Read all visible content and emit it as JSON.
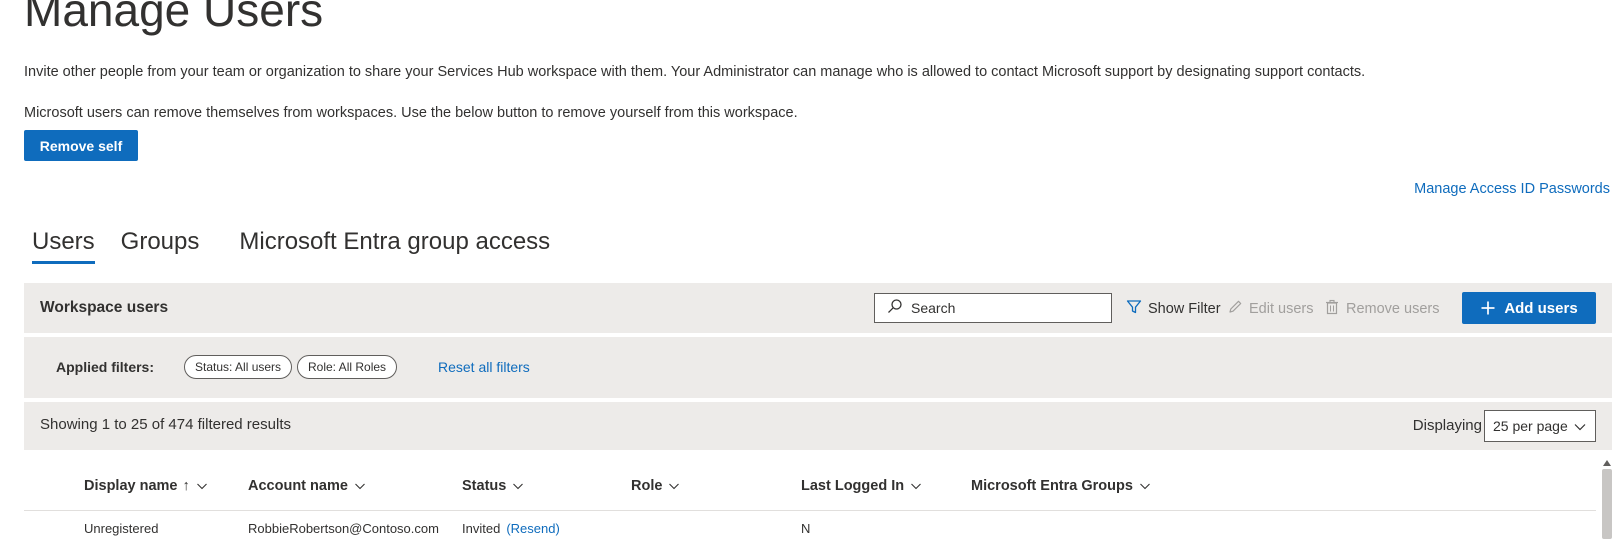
{
  "page": {
    "title": "Manage Users",
    "description1": "Invite other people from your team or organization to share your Services Hub workspace with them. Your Administrator can manage who is allowed to contact Microsoft support by designating support contacts.",
    "description2": "Microsoft users can remove themselves from workspaces. Use the below button to remove yourself from this workspace.",
    "remove_self_label": "Remove self",
    "access_link": "Manage Access ID Passwords"
  },
  "tabs": [
    {
      "label": "Users",
      "active": true
    },
    {
      "label": "Groups",
      "active": false
    },
    {
      "label": "Microsoft Entra group access",
      "active": false
    }
  ],
  "toolbar": {
    "title": "Workspace users",
    "search_placeholder": "Search",
    "show_filter": "Show Filter",
    "edit_users": "Edit users",
    "remove_users": "Remove users",
    "add_users": "Add users"
  },
  "filters": {
    "label": "Applied filters:",
    "chips": [
      "Status: All users",
      "Role: All Roles"
    ],
    "reset": "Reset all filters"
  },
  "results": {
    "summary": "Showing 1 to 25 of 474 filtered results",
    "displaying_label": "Displaying",
    "per_page": "25 per page"
  },
  "table": {
    "columns": [
      {
        "label": "Display name",
        "sort": "↑"
      },
      {
        "label": "Account name"
      },
      {
        "label": "Status"
      },
      {
        "label": "Role"
      },
      {
        "label": "Last Logged In"
      },
      {
        "label": "Microsoft Entra Groups"
      }
    ],
    "rows": [
      {
        "display_name": "Unregistered",
        "account_name": "RobbieRobertson@Contoso.com",
        "status": "Invited",
        "resend": "(Resend)",
        "last_logged_in": "N"
      }
    ]
  },
  "colors": {
    "accent": "#0f6cbd",
    "toolbar_bg": "#edebe9",
    "text": "#323130",
    "disabled": "#a19f9d"
  }
}
